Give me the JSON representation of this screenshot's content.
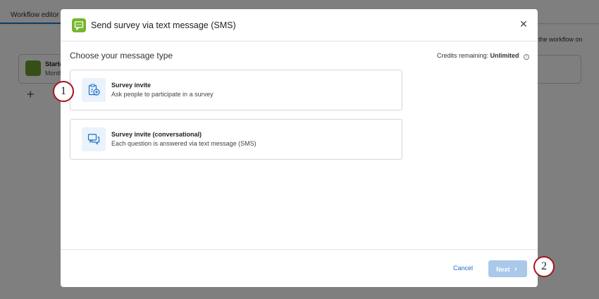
{
  "background": {
    "tab_label": "Workflow editor",
    "card_title": "Starte",
    "card_subtitle": "Month",
    "plus": "+",
    "right_text": "the workflow on"
  },
  "modal": {
    "title": "Send survey via text message (SMS)",
    "close_glyph": "✕",
    "section_title": "Choose your message type",
    "credits_label": "Credits remaining:",
    "credits_value": "Unlimited",
    "info_glyph": "i",
    "options": [
      {
        "title": "Survey invite",
        "subtitle": "Ask people to participate in a survey",
        "icon": "clipboard-add-icon"
      },
      {
        "title": "Survey invite (conversational)",
        "subtitle": "Each question is answered via text message (SMS)",
        "icon": "chat-bubbles-icon"
      }
    ],
    "cancel_label": "Cancel",
    "next_label": "Next",
    "next_glyph": "›"
  },
  "markers": [
    "1",
    "2"
  ],
  "colors": {
    "accent": "#1a6fc8",
    "sms_green": "#74b72e",
    "marker_red": "#a5151b",
    "next_disabled": "#a9c8ea"
  }
}
